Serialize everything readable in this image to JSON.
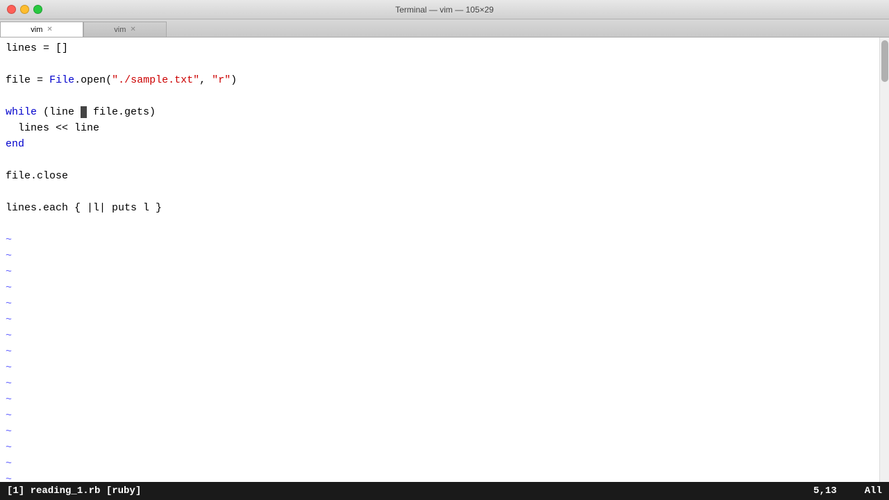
{
  "window": {
    "title": "Terminal — vim — 105×29"
  },
  "titlebar": {
    "title": "Terminal — vim — 105×29"
  },
  "tabs": [
    {
      "id": "tab1",
      "label": "vim",
      "active": true
    },
    {
      "id": "tab2",
      "label": "vim",
      "active": false
    }
  ],
  "editor": {
    "lines": [
      {
        "content": "lines = []",
        "type": "code"
      },
      {
        "content": "",
        "type": "blank"
      },
      {
        "content": "file = File.open(\"./sample.txt\", \"r\")",
        "type": "code"
      },
      {
        "content": "",
        "type": "blank"
      },
      {
        "content": "while (line = file.gets)",
        "type": "code"
      },
      {
        "content": "  lines << line",
        "type": "code"
      },
      {
        "content": "end",
        "type": "code"
      },
      {
        "content": "",
        "type": "blank"
      },
      {
        "content": "file.close",
        "type": "code"
      },
      {
        "content": "",
        "type": "blank"
      },
      {
        "content": "lines.each { |l| puts l }",
        "type": "code"
      }
    ],
    "tildes": 17
  },
  "statusbar": {
    "left": "[1]  reading_1.rb [ruby]",
    "position": "5,13",
    "view": "All"
  },
  "colors": {
    "keyword": "#0000cc",
    "string": "#cc0000",
    "background": "#ffffff",
    "text": "#000000",
    "statusbar_bg": "#1a1a1a",
    "statusbar_fg": "#ffffff"
  }
}
